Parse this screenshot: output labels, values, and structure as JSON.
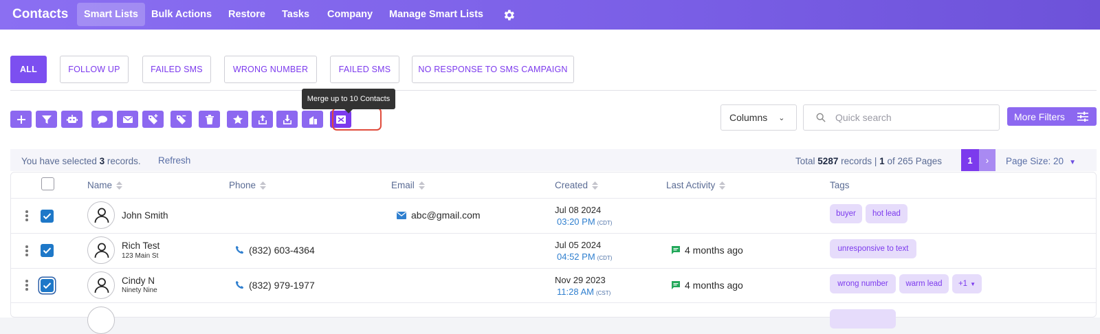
{
  "topbar": {
    "brand": "Contacts",
    "nav": [
      "Smart Lists",
      "Bulk Actions",
      "Restore",
      "Tasks",
      "Company",
      "Manage Smart Lists"
    ],
    "active_nav": "Smart Lists",
    "settings_icon": "gear-icon"
  },
  "smart_lists": [
    "ALL",
    "FOLLOW UP",
    "FAILED SMS",
    "WRONG NUMBER",
    "FAILED SMS",
    "NO RESPONSE TO SMS CAMPAIGN"
  ],
  "active_list": "ALL",
  "toolbar": {
    "icons": [
      "plus-icon",
      "filter-icon",
      "robot-icon",
      "chat-icon",
      "envelope-icon",
      "tag-add-icon",
      "tag-remove-icon",
      "trash-icon",
      "star-icon",
      "upload-icon",
      "download-icon",
      "company-icon",
      "merge-icon"
    ],
    "tooltip": "Merge up to 10 Contacts",
    "columns_label": "Columns",
    "search_placeholder": "Quick search",
    "more_filters_label": "More Filters"
  },
  "selection": {
    "prefix": "You have selected",
    "count": "3",
    "suffix": "records.",
    "refresh": "Refresh"
  },
  "pagination": {
    "total_prefix": "Total",
    "total": "5287",
    "total_suffix": "records",
    "separator": "|",
    "page": "1",
    "of_pages": "of 265 Pages",
    "current_page": "1",
    "next": "›",
    "page_size": "Page Size: 20"
  },
  "table": {
    "headers": [
      "Name",
      "Phone",
      "Email",
      "Created",
      "Last Activity",
      "Tags"
    ],
    "rows": [
      {
        "name": "John Smith",
        "sub": "",
        "phone": "",
        "email": "abc@gmail.com",
        "date": "Jul 08 2024",
        "time": "03:20 PM",
        "tz": "(CDT)",
        "activity": "",
        "tags": [
          "buyer",
          "hot lead"
        ],
        "more_tags": ""
      },
      {
        "name": "Rich Test",
        "sub": "123 Main St",
        "phone": "(832) 603-4364",
        "email": "",
        "date": "Jul 05 2024",
        "time": "04:52 PM",
        "tz": "(CDT)",
        "activity": "4 months ago",
        "tags": [
          "unresponsive to text"
        ],
        "more_tags": ""
      },
      {
        "name": "Cindy N",
        "sub": "Ninety Nine",
        "phone": "(832) 979-1977",
        "email": "",
        "date": "Nov 29 2023",
        "time": "11:28 AM",
        "tz": "(CST)",
        "activity": "4 months ago",
        "tags": [
          "wrong number",
          "warm lead"
        ],
        "more_tags": "+1"
      }
    ]
  },
  "colors": {
    "brand_purple": "#7c3aed",
    "topbar": "#7a5fe6",
    "checkbox_blue": "#1e78c8",
    "highlight_red": "#e04b3b"
  }
}
